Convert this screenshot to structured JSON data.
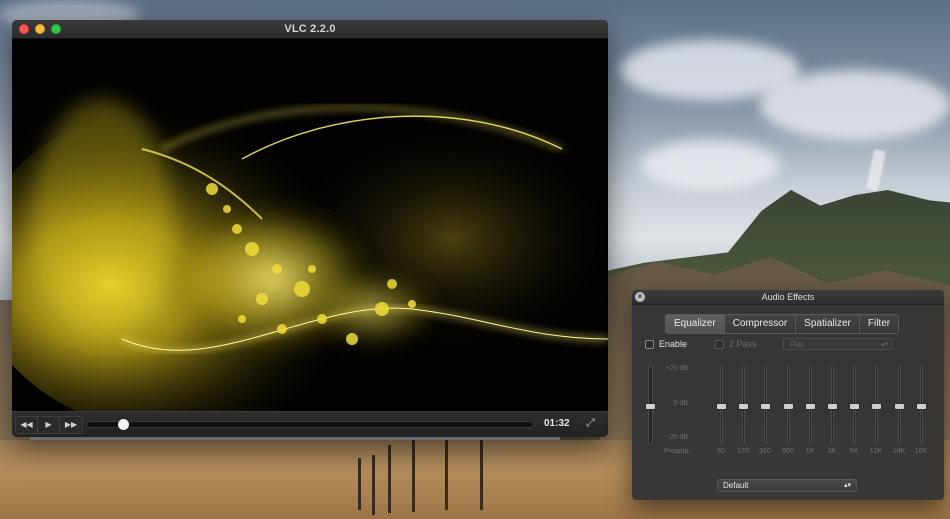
{
  "player": {
    "window_title": "VLC 2.2.0",
    "time_elapsed": "01:32",
    "playback_progress_fraction": 0.07,
    "controls": {
      "rewind_icon": "rewind-icon",
      "play_icon": "play-icon",
      "fast_forward_icon": "fast-forward-icon",
      "fullscreen_icon": "fullscreen-icon"
    },
    "visualization_color": "#e8d21a"
  },
  "audio_effects": {
    "title": "Audio Effects",
    "tabs": [
      {
        "label": "Equalizer",
        "active": true
      },
      {
        "label": "Compressor",
        "active": false
      },
      {
        "label": "Spatializer",
        "active": false
      },
      {
        "label": "Filter",
        "active": false
      }
    ],
    "enable_label": "Enable",
    "enable_checked": false,
    "two_pass_label": "2 Pass",
    "two_pass_checked": false,
    "preset_value": "Flat",
    "db_labels": {
      "top": "+20 dB",
      "middle": "0 dB",
      "bottom": "-20 dB"
    },
    "preamp_label": "Preamp",
    "preamp_db": 0,
    "bands": [
      {
        "label": "60",
        "db": 0
      },
      {
        "label": "170",
        "db": 0
      },
      {
        "label": "310",
        "db": 0
      },
      {
        "label": "600",
        "db": 0
      },
      {
        "label": "1K",
        "db": 0
      },
      {
        "label": "3K",
        "db": 0
      },
      {
        "label": "6K",
        "db": 0
      },
      {
        "label": "12K",
        "db": 0
      },
      {
        "label": "14K",
        "db": 0
      },
      {
        "label": "16K",
        "db": 0
      }
    ],
    "profile_value": "Default"
  }
}
